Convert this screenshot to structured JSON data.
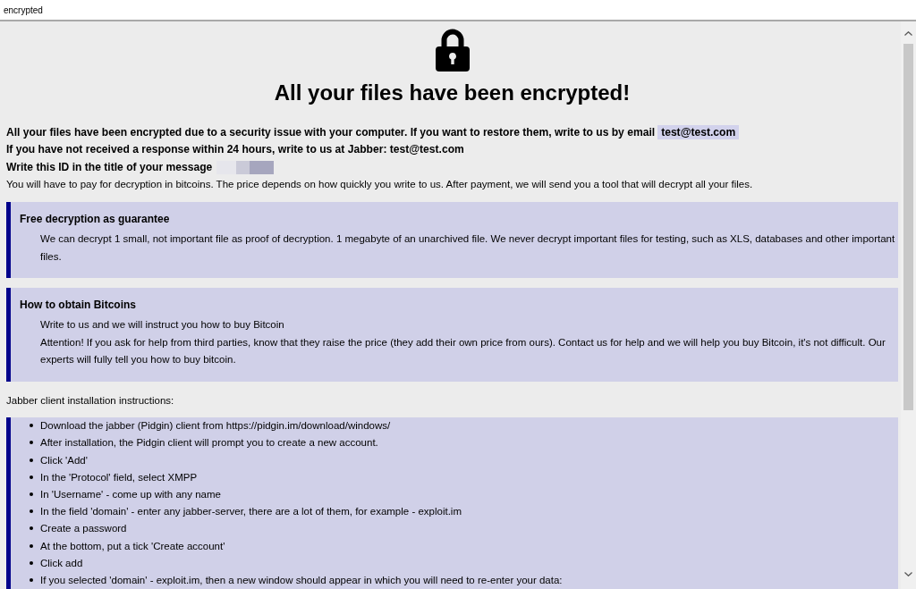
{
  "window": {
    "title": "encrypted"
  },
  "header": {
    "heading": "All your files have been encrypted!"
  },
  "notice": {
    "email_line": {
      "text": "All your files have been encrypted due to a security issue with your computer. If you want to restore them, write to us by email",
      "email": "test@test.com"
    },
    "jabber_line": "If you have not received a response within 24 hours, write to us at Jabber: test@test.com",
    "id_line": "Write this ID in the title of your message",
    "payment_line": "You will have to pay for decryption in bitcoins. The price depends on how quickly you write to us. After payment, we will send you a tool that will decrypt all your files."
  },
  "sections": [
    {
      "title": "Free decryption as guarantee",
      "paragraphs": [
        "We can decrypt 1 small, not important file as proof of decryption. 1 megabyte of an unarchived file. We never decrypt important files for testing, such as XLS, databases and other important files."
      ]
    },
    {
      "title": "How to obtain Bitcoins",
      "paragraphs": [
        "Write to us and we will instruct you how to buy Bitcoin",
        "Attention! If you ask for help from third parties, know that they raise the price (they add their own price from ours). Contact us for help and we will help you buy Bitcoin, it's not difficult. Our experts will fully tell you how to buy bitcoin."
      ]
    }
  ],
  "instructions": {
    "caption": "Jabber client installation instructions:",
    "steps": [
      "Download the jabber (Pidgin) client from https://pidgin.im/download/windows/",
      "After installation, the Pidgin client will prompt you to create a new account.",
      "Click 'Add'",
      "In the 'Protocol' field, select XMPP",
      "In 'Username' - come up with any name",
      "In the field 'domain' - enter any jabber-server, there are a lot of them, for example - exploit.im",
      "Create a password",
      "At the bottom, put a tick 'Create account'",
      "Click add",
      "If you selected 'domain' - exploit.im, then a new window should appear in which you will need to re-enter your data:"
    ]
  }
}
